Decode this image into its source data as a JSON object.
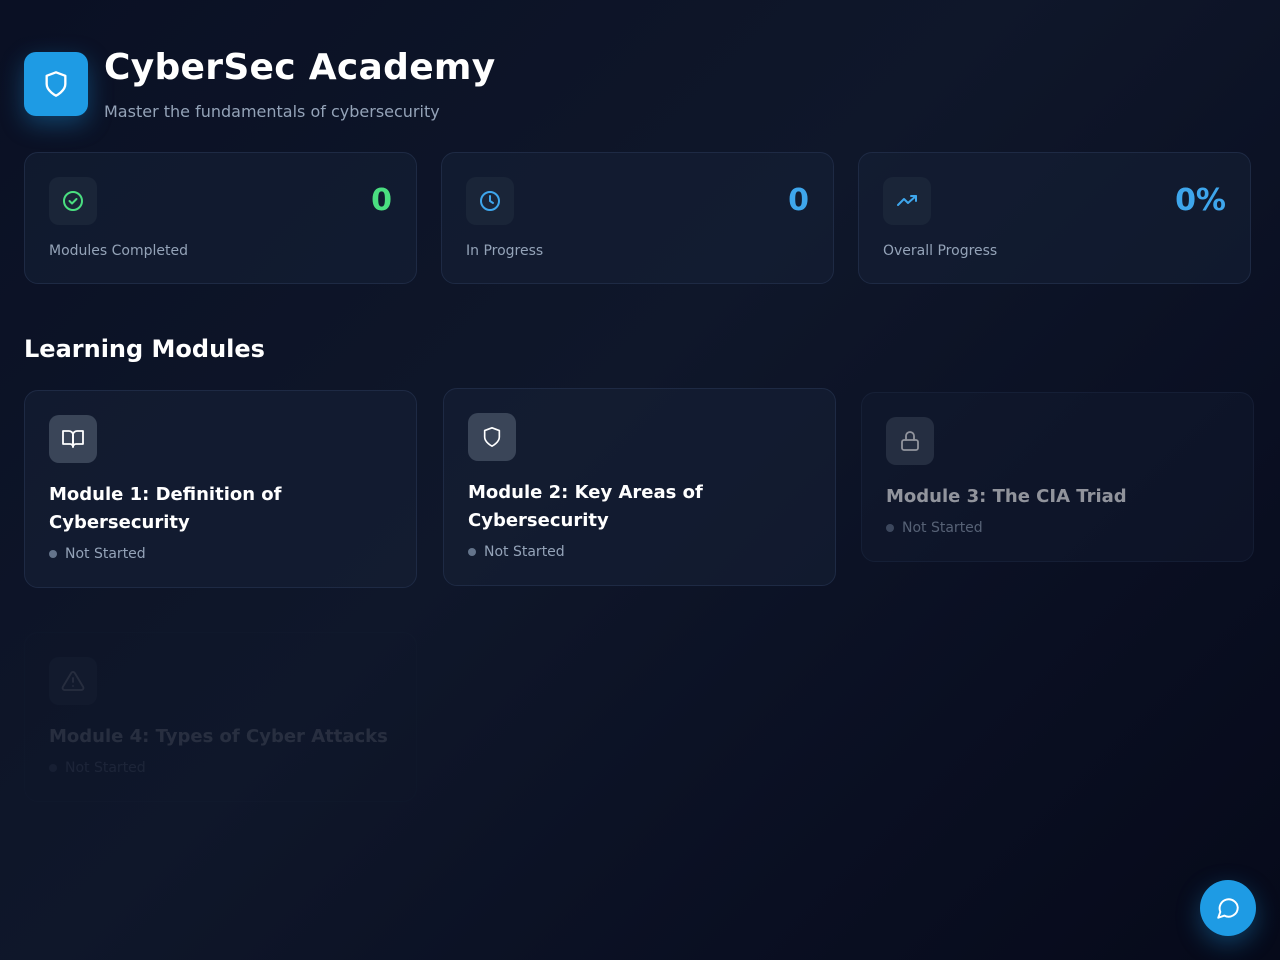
{
  "header": {
    "title": "CyberSec Academy",
    "subtitle": "Master the fundamentals of cybersecurity",
    "logo_icon": "shield-icon"
  },
  "stats": [
    {
      "label": "Modules Completed",
      "value": "0",
      "icon": "check-circle-icon",
      "color": "#4ade80"
    },
    {
      "label": "In Progress",
      "value": "0",
      "icon": "clock-icon",
      "color": "#3ea6ec"
    },
    {
      "label": "Overall Progress",
      "value": "0%",
      "icon": "trending-up-icon",
      "color": "#3ea6ec"
    }
  ],
  "section": {
    "title": "Learning Modules"
  },
  "modules": [
    {
      "title": "Module 1: Definition of Cybersecurity",
      "status": "Not Started",
      "icon": "book-open-icon"
    },
    {
      "title": "Module 2: Key Areas of Cybersecurity",
      "status": "Not Started",
      "icon": "shield-icon"
    },
    {
      "title": "Module 3: The CIA Triad",
      "status": "Not Started",
      "icon": "lock-icon"
    },
    {
      "title": "Module 4: Types of Cyber Attacks",
      "status": "Not Started",
      "icon": "alert-triangle-icon"
    }
  ],
  "chat": {
    "icon": "message-circle-icon"
  },
  "colors": {
    "accent": "#1e9be4",
    "success": "#4ade80",
    "background": "#0f172a",
    "muted_text": "#94a3b8"
  }
}
